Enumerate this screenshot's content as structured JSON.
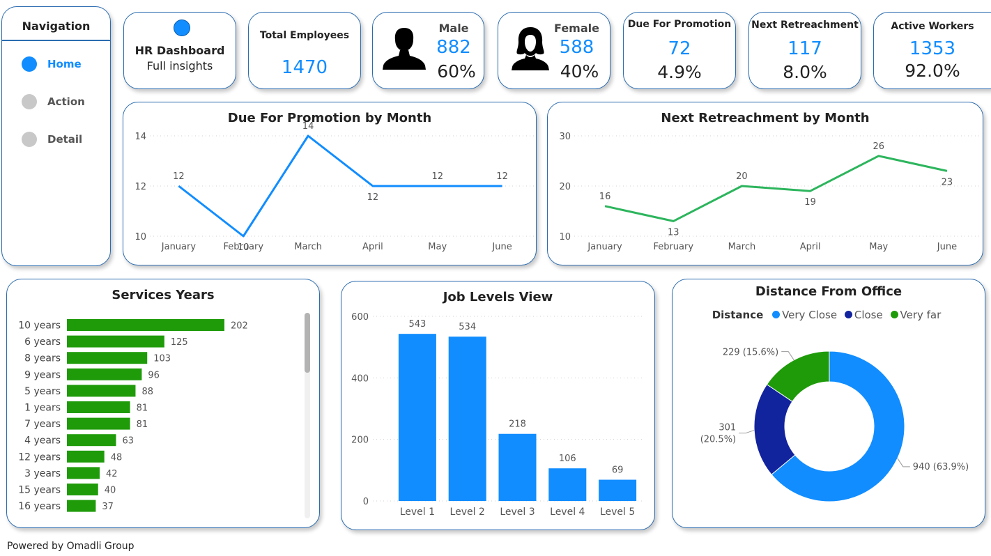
{
  "navigation": {
    "title": "Navigation",
    "items": [
      {
        "label": "Home",
        "active": true
      },
      {
        "label": "Action",
        "active": false
      },
      {
        "label": "Detail",
        "active": false
      }
    ]
  },
  "kpis": {
    "dashboard": {
      "title": "HR Dashboard",
      "subtitle": "Full insights"
    },
    "total": {
      "label": "Total Employees",
      "value": "1470"
    },
    "male": {
      "label": "Male",
      "value": "882",
      "pct": "60%"
    },
    "female": {
      "label": "Female",
      "value": "588",
      "pct": "40%"
    },
    "promotion": {
      "label": "Due For Promotion",
      "value": "72",
      "pct": "4.9%"
    },
    "retrenchment": {
      "label": "Next Retreachment",
      "value": "117",
      "pct": "8.0%"
    },
    "active": {
      "label": "Active Workers",
      "value": "1353",
      "pct": "92.0%"
    }
  },
  "footer": "Powered by Omadli Group",
  "colors": {
    "accent": "#118dff",
    "green_line": "#2db55d",
    "bar_green": "#1f9b0a",
    "dark_blue": "#12239e",
    "border": "#2b6cb0"
  },
  "chart_data": [
    {
      "type": "line",
      "title": "Due For Promotion by Month",
      "categories": [
        "January",
        "February",
        "March",
        "April",
        "May",
        "June"
      ],
      "values": [
        12,
        10,
        14,
        12,
        12,
        12
      ],
      "ylim": [
        10,
        14
      ],
      "yticks": [
        10,
        12,
        14
      ],
      "color": "#118dff",
      "grid": true
    },
    {
      "type": "line",
      "title": "Next Retreachment by Month",
      "categories": [
        "January",
        "February",
        "March",
        "April",
        "May",
        "June"
      ],
      "values": [
        16,
        13,
        20,
        19,
        26,
        23
      ],
      "ylim": [
        10,
        30
      ],
      "yticks": [
        10,
        20,
        30
      ],
      "color": "#2db55d",
      "grid": true
    },
    {
      "type": "bar",
      "orientation": "horizontal",
      "title": "Services Years",
      "categories": [
        "10 years",
        "6 years",
        "8 years",
        "9 years",
        "5 years",
        "1 years",
        "7 years",
        "4 years",
        "12 years",
        "3 years",
        "15 years",
        "16 years"
      ],
      "values": [
        202,
        125,
        103,
        96,
        88,
        81,
        81,
        63,
        48,
        42,
        40,
        37
      ],
      "color": "#1f9b0a"
    },
    {
      "type": "bar",
      "title": "Job Levels View",
      "categories": [
        "Level 1",
        "Level 2",
        "Level 3",
        "Level 4",
        "Level 5"
      ],
      "values": [
        543,
        534,
        218,
        106,
        69
      ],
      "ylim": [
        0,
        600
      ],
      "yticks": [
        0,
        200,
        400,
        600
      ],
      "color": "#118dff",
      "grid": true
    },
    {
      "type": "pie",
      "donut": true,
      "title": "Distance From Office",
      "legend_title": "Distance",
      "legend_position": "top",
      "slices": [
        {
          "name": "Very Close",
          "value": 940,
          "label": "940 (63.9%)",
          "color": "#118dff"
        },
        {
          "name": "Close",
          "value": 301,
          "label_line1": "301",
          "label_line2": "(20.5%)",
          "color": "#12239e"
        },
        {
          "name": "Very far",
          "value": 229,
          "label": "229 (15.6%)",
          "color": "#1f9b0a"
        }
      ]
    }
  ]
}
